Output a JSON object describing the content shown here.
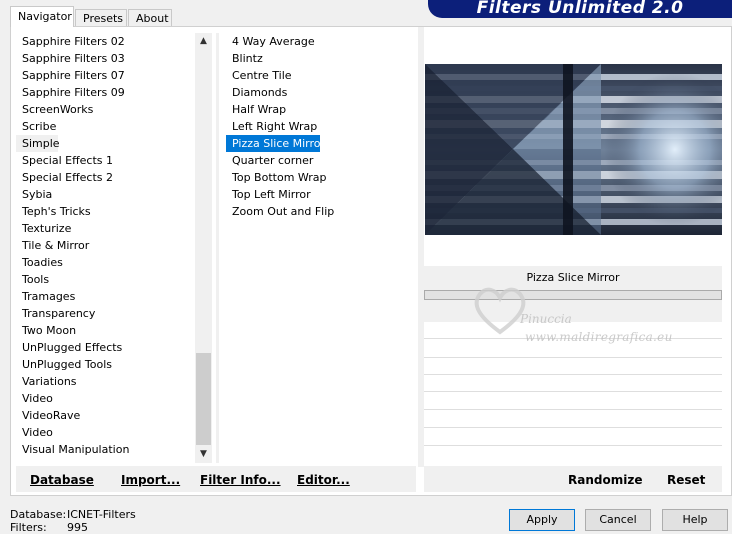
{
  "tabs": [
    {
      "label": "Navigator"
    },
    {
      "label": "Presets"
    },
    {
      "label": "About"
    }
  ],
  "banner": "Filters Unlimited 2.0",
  "categories": [
    "Sapphire Filters 02",
    "Sapphire Filters 03",
    "Sapphire Filters 07",
    "Sapphire Filters 09",
    "ScreenWorks",
    "Scribe",
    "Simple",
    "Special Effects 1",
    "Special Effects 2",
    "Sybia",
    "Teph's Tricks",
    "Texturize",
    "Tile & Mirror",
    "Toadies",
    "Tools",
    "Tramages",
    "Transparency",
    "Two Moon",
    "UnPlugged Effects",
    "UnPlugged Tools",
    "Variations",
    "Video",
    "VideoRave",
    "Video",
    "Visual Manipulation"
  ],
  "selected_category": "Simple",
  "filters": [
    "4 Way Average",
    "Blintz",
    "Centre Tile",
    "Diamonds",
    "Half Wrap",
    "Left Right Wrap",
    "Pizza Slice Mirror",
    "Quarter corner",
    "Top Bottom Wrap",
    "Top Left Mirror",
    "Zoom Out and Flip"
  ],
  "selected_filter": "Pizza Slice Mirror",
  "filter_name": "Pizza Slice Mirror",
  "watermark": {
    "name": "Pinuccia",
    "url": "www.maldiregrafica.eu"
  },
  "buttons": {
    "database": "Database",
    "import": "Import...",
    "filter_info": "Filter Info...",
    "editor": "Editor...",
    "randomize": "Randomize",
    "reset": "Reset",
    "apply": "Apply",
    "cancel": "Cancel",
    "help": "Help"
  },
  "footer": {
    "database_label": "Database:",
    "database_value": "ICNET-Filters",
    "filters_label": "Filters:",
    "filters_value": "995"
  },
  "colors": {
    "banner": "#0c1f7a",
    "selection": "#0078d7"
  }
}
